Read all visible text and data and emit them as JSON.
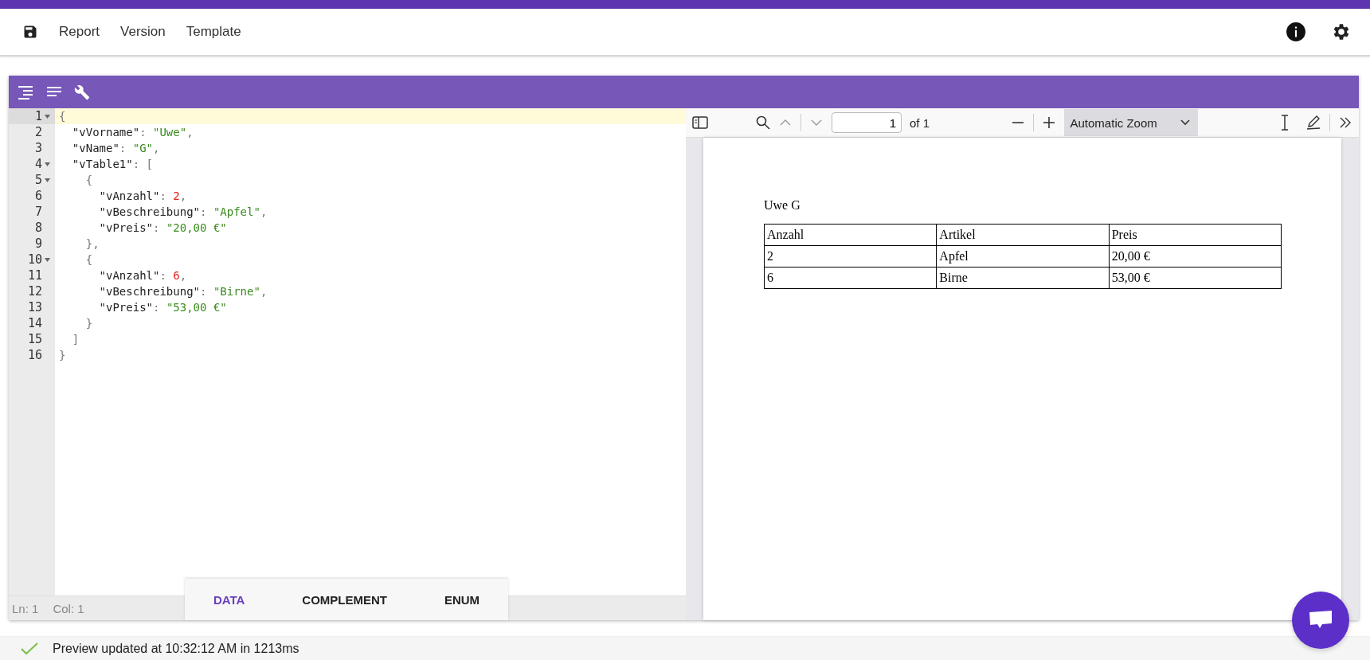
{
  "menu": [
    {
      "label": "Report"
    },
    {
      "label": "Version"
    },
    {
      "label": "Template"
    }
  ],
  "editor": {
    "lines": [
      {
        "number": "1",
        "foldable": true,
        "active": true,
        "tokens": [
          {
            "kind": "punct",
            "text": "{"
          }
        ]
      },
      {
        "number": "2",
        "foldable": false,
        "active": false,
        "tokens": [
          {
            "kind": "key",
            "text": "  \"vVorname\""
          },
          {
            "kind": "punct",
            "text": ": "
          },
          {
            "kind": "string",
            "text": "\"Uwe\""
          },
          {
            "kind": "punct",
            "text": ","
          }
        ]
      },
      {
        "number": "3",
        "foldable": false,
        "active": false,
        "tokens": [
          {
            "kind": "key",
            "text": "  \"vName\""
          },
          {
            "kind": "punct",
            "text": ": "
          },
          {
            "kind": "string",
            "text": "\"G\""
          },
          {
            "kind": "punct",
            "text": ","
          }
        ]
      },
      {
        "number": "4",
        "foldable": true,
        "active": false,
        "tokens": [
          {
            "kind": "key",
            "text": "  \"vTable1\""
          },
          {
            "kind": "punct",
            "text": ": ["
          }
        ]
      },
      {
        "number": "5",
        "foldable": true,
        "active": false,
        "tokens": [
          {
            "kind": "punct",
            "text": "    {"
          }
        ]
      },
      {
        "number": "6",
        "foldable": false,
        "active": false,
        "tokens": [
          {
            "kind": "key",
            "text": "      \"vAnzahl\""
          },
          {
            "kind": "punct",
            "text": ": "
          },
          {
            "kind": "number",
            "text": "2"
          },
          {
            "kind": "punct",
            "text": ","
          }
        ]
      },
      {
        "number": "7",
        "foldable": false,
        "active": false,
        "tokens": [
          {
            "kind": "key",
            "text": "      \"vBeschreibung\""
          },
          {
            "kind": "punct",
            "text": ": "
          },
          {
            "kind": "string",
            "text": "\"Apfel\""
          },
          {
            "kind": "punct",
            "text": ","
          }
        ]
      },
      {
        "number": "8",
        "foldable": false,
        "active": false,
        "tokens": [
          {
            "kind": "key",
            "text": "      \"vPreis\""
          },
          {
            "kind": "punct",
            "text": ": "
          },
          {
            "kind": "string",
            "text": "\"20,00 €\""
          }
        ]
      },
      {
        "number": "9",
        "foldable": false,
        "active": false,
        "tokens": [
          {
            "kind": "punct",
            "text": "    },"
          }
        ]
      },
      {
        "number": "10",
        "foldable": true,
        "active": false,
        "tokens": [
          {
            "kind": "punct",
            "text": "    {"
          }
        ]
      },
      {
        "number": "11",
        "foldable": false,
        "active": false,
        "tokens": [
          {
            "kind": "key",
            "text": "      \"vAnzahl\""
          },
          {
            "kind": "punct",
            "text": ": "
          },
          {
            "kind": "number",
            "text": "6"
          },
          {
            "kind": "punct",
            "text": ","
          }
        ]
      },
      {
        "number": "12",
        "foldable": false,
        "active": false,
        "tokens": [
          {
            "kind": "key",
            "text": "      \"vBeschreibung\""
          },
          {
            "kind": "punct",
            "text": ": "
          },
          {
            "kind": "string",
            "text": "\"Birne\""
          },
          {
            "kind": "punct",
            "text": ","
          }
        ]
      },
      {
        "number": "13",
        "foldable": false,
        "active": false,
        "tokens": [
          {
            "kind": "key",
            "text": "      \"vPreis\""
          },
          {
            "kind": "punct",
            "text": ": "
          },
          {
            "kind": "string",
            "text": "\"53,00 €\""
          }
        ]
      },
      {
        "number": "14",
        "foldable": false,
        "active": false,
        "tokens": [
          {
            "kind": "punct",
            "text": "    }"
          }
        ]
      },
      {
        "number": "15",
        "foldable": false,
        "active": false,
        "tokens": [
          {
            "kind": "punct",
            "text": "  ]"
          }
        ]
      },
      {
        "number": "16",
        "foldable": false,
        "active": false,
        "tokens": [
          {
            "kind": "punct",
            "text": "}"
          }
        ]
      }
    ],
    "status": {
      "line": "Ln: 1",
      "column": "Col: 1"
    },
    "tabs": [
      {
        "label": "DATA",
        "selected": true
      },
      {
        "label": "COMPLEMENT",
        "selected": false
      },
      {
        "label": "ENUM",
        "selected": false
      }
    ]
  },
  "viewer": {
    "page_input": "1",
    "page_count": "of 1",
    "zoom": "Automatic Zoom",
    "document": {
      "heading": "Uwe G",
      "table": {
        "columns": [
          "Anzahl",
          "Artikel",
          "Preis"
        ],
        "rows": [
          [
            "2",
            "Apfel",
            "20,00 €"
          ],
          [
            "6",
            "Birne",
            "53,00 €"
          ]
        ]
      }
    }
  },
  "status_bar": {
    "message": "Preview updated at 10:32:12 AM in 1213ms"
  }
}
